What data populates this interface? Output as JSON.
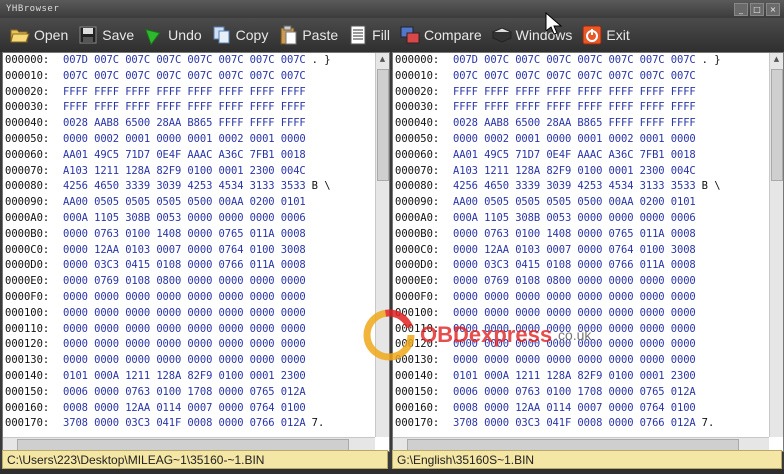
{
  "window": {
    "title": "YHBrowser",
    "controls": [
      "_",
      "□",
      "×"
    ]
  },
  "toolbar": [
    {
      "id": "open",
      "label": "Open",
      "icon": "folder-open-icon"
    },
    {
      "id": "save",
      "label": "Save",
      "icon": "floppy-disk-icon"
    },
    {
      "id": "undo",
      "label": "Undo",
      "icon": "undo-arrow-icon"
    },
    {
      "id": "copy",
      "label": "Copy",
      "icon": "copy-icon"
    },
    {
      "id": "paste",
      "label": "Paste",
      "icon": "clipboard-icon"
    },
    {
      "id": "fill",
      "label": "Fill",
      "icon": "fill-document-icon"
    },
    {
      "id": "compare",
      "label": "Compare",
      "icon": "compare-icon"
    },
    {
      "id": "windows",
      "label": "Windows",
      "icon": "windows-icon"
    },
    {
      "id": "exit",
      "label": "Exit",
      "icon": "exit-icon"
    }
  ],
  "hex_rows": [
    {
      "addr": "000000:",
      "bytes": "007D 007C 007C 007C 007C 007C 007C 007C",
      "ascii": ". }"
    },
    {
      "addr": "000010:",
      "bytes": "007C 007C 007C 007C 007C 007C 007C 007C",
      "ascii": ""
    },
    {
      "addr": "000020:",
      "bytes": "FFFF FFFF FFFF FFFF FFFF FFFF FFFF FFFF",
      "ascii": ""
    },
    {
      "addr": "000030:",
      "bytes": "FFFF FFFF FFFF FFFF FFFF FFFF FFFF FFFF",
      "ascii": ""
    },
    {
      "addr": "000040:",
      "bytes": "0028 AAB8 6500 28AA B865 FFFF FFFF FFFF",
      "ascii": ""
    },
    {
      "addr": "000050:",
      "bytes": "0000 0002 0001 0000 0001 0002 0001 0000",
      "ascii": ""
    },
    {
      "addr": "000060:",
      "bytes": "AA01 49C5 71D7 0E4F AAAC A36C 7FB1 0018",
      "ascii": ""
    },
    {
      "addr": "000070:",
      "bytes": "A103 1211 128A 82F9 0100 0001 2300 004C",
      "ascii": ""
    },
    {
      "addr": "000080:",
      "bytes": "4256 4650 3339 3039 4253 4534 3133 3533",
      "ascii": "B \\"
    },
    {
      "addr": "000090:",
      "bytes": "AA00 0505 0505 0505 0500 00AA 0200 0101",
      "ascii": ""
    },
    {
      "addr": "0000A0:",
      "bytes": "000A 1105 308B 0053 0000 0000 0000 0006",
      "ascii": ""
    },
    {
      "addr": "0000B0:",
      "bytes": "0000 0763 0100 1408 0000 0765 011A 0008",
      "ascii": ""
    },
    {
      "addr": "0000C0:",
      "bytes": "0000 12AA 0103 0007 0000 0764 0100 3008",
      "ascii": ""
    },
    {
      "addr": "0000D0:",
      "bytes": "0000 03C3 0415 0108 0000 0766 011A 0008",
      "ascii": ""
    },
    {
      "addr": "0000E0:",
      "bytes": "0000 0769 0108 0800 0000 0000 0000 0000",
      "ascii": ""
    },
    {
      "addr": "0000F0:",
      "bytes": "0000 0000 0000 0000 0000 0000 0000 0000",
      "ascii": ""
    },
    {
      "addr": "000100:",
      "bytes": "0000 0000 0000 0000 0000 0000 0000 0000",
      "ascii": ""
    },
    {
      "addr": "000110:",
      "bytes": "0000 0000 0000 0000 0000 0000 0000 0000",
      "ascii": ""
    },
    {
      "addr": "000120:",
      "bytes": "0000 0000 0000 0000 0000 0000 0000 0000",
      "ascii": ""
    },
    {
      "addr": "000130:",
      "bytes": "0000 0000 0000 0000 0000 0000 0000 0000",
      "ascii": ""
    },
    {
      "addr": "000140:",
      "bytes": "0101 000A 1211 128A 82F9 0100 0001 2300",
      "ascii": ""
    },
    {
      "addr": "000150:",
      "bytes": "0006 0000 0763 0100 1708 0000 0765 012A",
      "ascii": ""
    },
    {
      "addr": "000160:",
      "bytes": "0008 0000 12AA 0114 0007 0000 0764 0100",
      "ascii": ""
    },
    {
      "addr": "000170:",
      "bytes": "3708 0000 03C3 041F 0008 0000 0766 012A",
      "ascii": "7."
    }
  ],
  "left_panel": {
    "path": "C:\\Users\\223\\Desktop\\MILEAG~1\\35160-~1.BIN"
  },
  "right_panel": {
    "path": "G:\\English\\35160S~1.BIN"
  },
  "watermark": {
    "brand": "OBDexpress",
    "suffix": ".co.uk"
  }
}
